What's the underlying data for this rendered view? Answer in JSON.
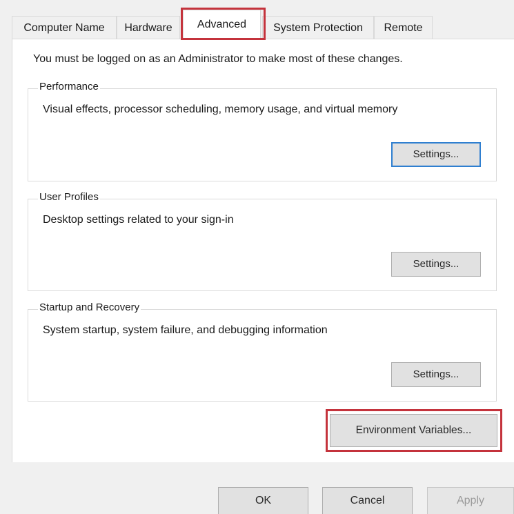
{
  "tabs": [
    {
      "label": "Computer Name"
    },
    {
      "label": "Hardware"
    },
    {
      "label": "Advanced"
    },
    {
      "label": "System Protection"
    },
    {
      "label": "Remote"
    }
  ],
  "active_tab": "Advanced",
  "notice": "You must be logged on as an Administrator to make most of these changes.",
  "performance": {
    "title": "Performance",
    "description": "Visual effects, processor scheduling, memory usage, and virtual memory",
    "button": "Settings..."
  },
  "user_profiles": {
    "title": "User Profiles",
    "description": "Desktop settings related to your sign-in",
    "button": "Settings..."
  },
  "startup_recovery": {
    "title": "Startup and Recovery",
    "description": "System startup, system failure, and debugging information",
    "button": "Settings..."
  },
  "environment_button": "Environment Variables...",
  "footer": {
    "ok": "OK",
    "cancel": "Cancel",
    "apply": "Apply"
  },
  "colors": {
    "highlight": "#c4333c",
    "focus": "#2f7fd0"
  }
}
